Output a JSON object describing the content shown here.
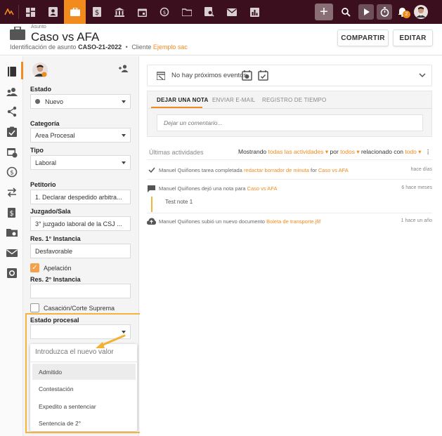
{
  "colors": {
    "topbar": "#3b0f1e",
    "accent": "#f28b1e",
    "highlight": "#f5b33b"
  },
  "topbar": {
    "icons": [
      "logo-icon",
      "dashboard-icon",
      "contacts-icon",
      "briefcase-icon",
      "billing-icon",
      "bank-icon",
      "calendar-icon",
      "history-icon",
      "folder-icon",
      "document-search-icon",
      "mail-icon",
      "reports-icon"
    ],
    "notification_count": "2"
  },
  "header": {
    "asunto_label": "Asunto",
    "title": "Caso vs AFA",
    "id_label": "Identificación de asunto",
    "id_value": "CASO-21-2022",
    "bullet": "•",
    "client_label": "Cliente",
    "client_value": "Ejemplo sac",
    "share_button": "COMPARTIR",
    "edit_button": "EDITAR"
  },
  "fields": {
    "estado_label": "Estado",
    "estado_value": "Nuevo",
    "categoria_label": "Categoría",
    "categoria_value": "Area Procesal",
    "tipo_label": "Tipo",
    "tipo_value": "Laboral",
    "petitorio_label": "Petitorio",
    "petitorio_value": "1. Declarar despedido arbitra...",
    "juzgado_label": "Juzgado/Sala",
    "juzgado_value": "3° juzgado laboral de la CSJ ...",
    "res1_label": "Res. 1° Instancia",
    "res1_value": "Desfavorable",
    "apelacion_label": "Apelación",
    "apelacion_checked": true,
    "res2_label": "Res. 2° Instancia",
    "res2_value": "",
    "casacion_label": "Casación/Corte Suprema",
    "casacion_checked": false,
    "estado_procesal_label": "Estado procesal",
    "estado_procesal_value": ""
  },
  "dropdown": {
    "placeholder": "Introduzca el nuevo valor",
    "options": [
      "Admitido",
      "Contestación",
      "Expedito a sentenciar",
      "Sentencia de 2°"
    ],
    "highlighted": "Admitido"
  },
  "events": {
    "text": "No hay próximos eventos"
  },
  "notes": {
    "tabs": [
      "DEJAR UNA NOTA",
      "ENVIAR E-MAIL",
      "REGISTRO DE TIEMPO"
    ],
    "active_tab": "DEJAR UNA NOTA",
    "comment_placeholder": "Dejar un comentario..."
  },
  "activities": {
    "title": "Últimas actividades",
    "showing": "Mostrando",
    "filter_all": "todas las actividades",
    "by": "por",
    "by_value": "todos",
    "related": "relacionado con",
    "related_value": "todo",
    "items": [
      {
        "icon": "check-icon",
        "actor": "Manuel Quiñones",
        "action": "tarea completada",
        "target": "redactar borrador de minuta",
        "for": "for",
        "matter": "Caso vs AFA",
        "time": "hace días"
      },
      {
        "icon": "comment-icon",
        "actor": "Manuel Quiñones",
        "action": "dejó una nota para",
        "target": "",
        "for": "",
        "matter": "Caso vs AFA",
        "time": "6 hace meses",
        "note": "Test note 1"
      },
      {
        "icon": "cloud-upload-icon",
        "actor": "Manuel Quiñones",
        "action": "subió un nuevo documento",
        "target": "Boleta de transporte.jfif",
        "for": "",
        "matter": "",
        "time": "1 hace un año"
      }
    ]
  }
}
